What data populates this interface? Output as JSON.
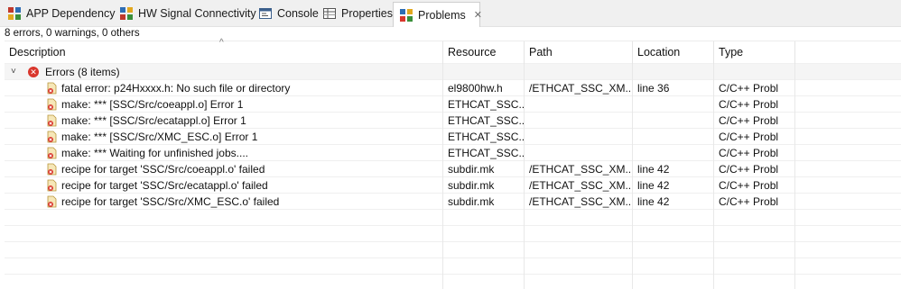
{
  "tabs": [
    {
      "label": "APP Dependency",
      "icon": "app-dependency-icon"
    },
    {
      "label": "HW Signal Connectivity",
      "icon": "hw-signal-icon"
    },
    {
      "label": "Console",
      "icon": "console-icon"
    },
    {
      "label": "Properties",
      "icon": "properties-icon"
    },
    {
      "label": "Problems",
      "icon": "problems-icon",
      "active": true
    }
  ],
  "summary": "8 errors, 0 warnings, 0 others",
  "columns": [
    "Description",
    "Resource",
    "Path",
    "Location",
    "Type"
  ],
  "group": {
    "label": "Errors (8 items)"
  },
  "rows": [
    {
      "description": "fatal error: p24Hxxxx.h: No such file or directory",
      "resource": "el9800hw.h",
      "path": "/ETHCAT_SSC_XM...",
      "location": "line 36",
      "type": "C/C++ Probl"
    },
    {
      "description": "make: *** [SSC/Src/coeappl.o] Error 1",
      "resource": "ETHCAT_SSC...",
      "path": "",
      "location": "",
      "type": "C/C++ Probl"
    },
    {
      "description": "make: *** [SSC/Src/ecatappl.o] Error 1",
      "resource": "ETHCAT_SSC...",
      "path": "",
      "location": "",
      "type": "C/C++ Probl"
    },
    {
      "description": "make: *** [SSC/Src/XMC_ESC.o] Error 1",
      "resource": "ETHCAT_SSC...",
      "path": "",
      "location": "",
      "type": "C/C++ Probl"
    },
    {
      "description": "make: *** Waiting for unfinished jobs....",
      "resource": "ETHCAT_SSC...",
      "path": "",
      "location": "",
      "type": "C/C++ Probl"
    },
    {
      "description": "recipe for target 'SSC/Src/coeappl.o' failed",
      "resource": "subdir.mk",
      "path": "/ETHCAT_SSC_XM...",
      "location": "line 42",
      "type": "C/C++ Probl"
    },
    {
      "description": "recipe for target 'SSC/Src/ecatappl.o' failed",
      "resource": "subdir.mk",
      "path": "/ETHCAT_SSC_XM...",
      "location": "line 42",
      "type": "C/C++ Probl"
    },
    {
      "description": "recipe for target 'SSC/Src/XMC_ESC.o' failed",
      "resource": "subdir.mk",
      "path": "/ETHCAT_SSC_XM...",
      "location": "line 42",
      "type": "C/C++ Probl"
    }
  ],
  "colors": {
    "error": "#d9372d",
    "tab_bg": "#f0f0f0",
    "group_bg": "#f5f5f5"
  }
}
